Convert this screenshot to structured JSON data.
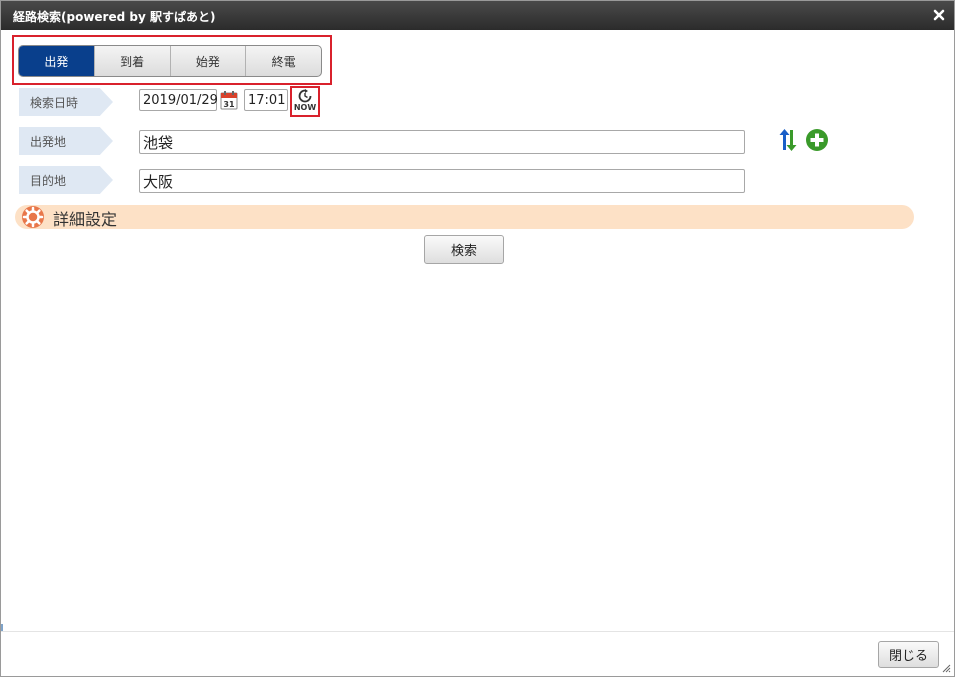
{
  "window": {
    "title": "経路検索(powered by 駅すぱあと)",
    "close_icon": "close-icon"
  },
  "tabs": [
    {
      "label": "出発",
      "active": true
    },
    {
      "label": "到着",
      "active": false
    },
    {
      "label": "始発",
      "active": false
    },
    {
      "label": "終電",
      "active": false
    }
  ],
  "form": {
    "date_label": "検索日時",
    "date_value": "2019/01/29",
    "calendar_icon_text": "31",
    "time_value": "17:01",
    "now_label": "NOW",
    "from_label": "出発地",
    "from_value": "池袋",
    "to_label": "目的地",
    "to_value": "大阪"
  },
  "detail": {
    "label": "詳細設定"
  },
  "buttons": {
    "search": "検索",
    "close": "閉じる"
  },
  "colors": {
    "titlebar": "#2b2b2b",
    "tab_active": "#093f8c",
    "highlight": "#d9212c",
    "label_bg": "#dfe8f3",
    "detail_bg": "#fde1c6",
    "swap_up": "#1a5fc8",
    "swap_down": "#3a9a2a",
    "add": "#3a9a2a"
  }
}
